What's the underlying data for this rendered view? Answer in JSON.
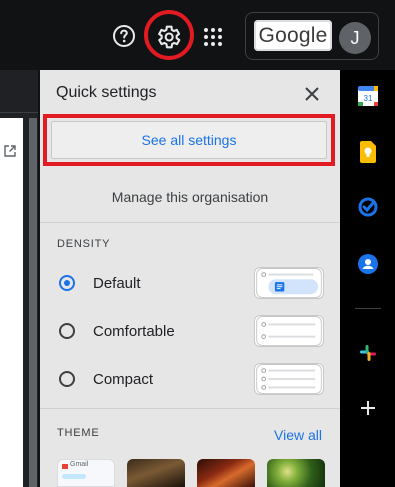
{
  "header": {
    "logo_text": "Google",
    "avatar_initial": "J"
  },
  "quick_settings": {
    "title": "Quick settings",
    "see_all_label": "See all settings",
    "manage_label": "Manage this organisation",
    "density": {
      "heading": "DENSITY",
      "options": [
        {
          "label": "Default",
          "selected": true
        },
        {
          "label": "Comfortable",
          "selected": false
        },
        {
          "label": "Compact",
          "selected": false
        }
      ]
    },
    "theme": {
      "heading": "THEME",
      "view_all_label": "View all"
    }
  },
  "theme_thumbnail_text": [
    "Gmail"
  ],
  "colors": {
    "accent": "#1a73e8",
    "highlight_red": "#e21b23",
    "panel_bg": "#e6e6e6"
  },
  "icons": [
    "help-icon",
    "gear-icon",
    "apps-grid-icon",
    "close-icon",
    "open-in-new-icon",
    "calendar-icon",
    "keep-icon",
    "tasks-icon",
    "contacts-icon",
    "slack-icon",
    "add-icon"
  ]
}
